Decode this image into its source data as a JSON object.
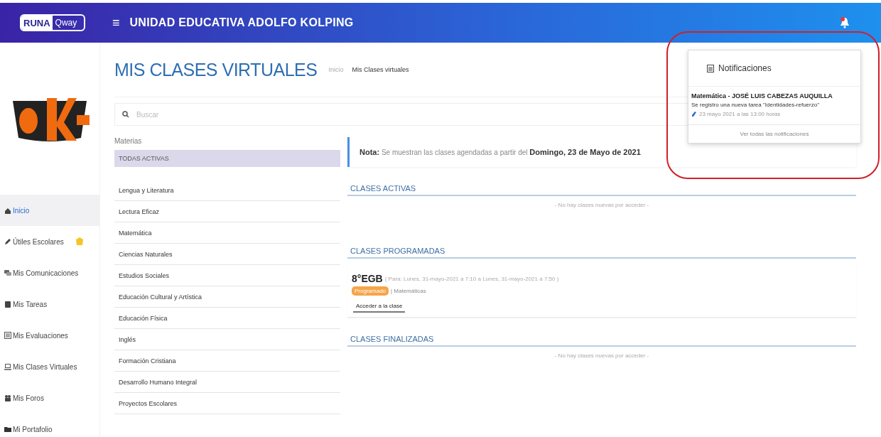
{
  "header": {
    "logo_main": "RUNA",
    "logo_tail": "Qway",
    "menu_glyph": "≡",
    "school": "UNIDAD EDUCATIVA ADOLFO KOLPING"
  },
  "sidebar": {
    "items": [
      {
        "label": "Inicio",
        "selected": true
      },
      {
        "label": "Útiles Escolares",
        "selected": false,
        "badge": true
      },
      {
        "label": "Mis Comunicaciones",
        "selected": false
      },
      {
        "label": "Mis Tareas",
        "selected": false
      },
      {
        "label": "Mis Evaluaciones",
        "selected": false
      },
      {
        "label": "Mis Clases Virtuales",
        "selected": false
      },
      {
        "label": "Mis Foros",
        "selected": false
      },
      {
        "label": "Mi Portafolio",
        "selected": false
      }
    ]
  },
  "page": {
    "title": "MIS CLASES VIRTUALES",
    "breadcrumb": [
      "Inicio",
      "Mis Clases virtuales"
    ]
  },
  "search": {
    "placeholder": "Buscar"
  },
  "subjects": {
    "heading": "Materias",
    "items": [
      {
        "label": "TODAS ACTIVAS",
        "selected": true
      },
      {
        "label": "Lengua y Literatura",
        "selected": false
      },
      {
        "label": "Lectura Eficaz",
        "selected": false
      },
      {
        "label": "Matemática",
        "selected": false
      },
      {
        "label": "Ciencias Naturales",
        "selected": false
      },
      {
        "label": "Estudios Sociales",
        "selected": false
      },
      {
        "label": "Educación Cultural y Artística",
        "selected": false
      },
      {
        "label": "Educación Física",
        "selected": false
      },
      {
        "label": "Inglés",
        "selected": false
      },
      {
        "label": "Formación Cristiana",
        "selected": false
      },
      {
        "label": "Desarrollo Humano Integral",
        "selected": false
      },
      {
        "label": "Proyectos Escolares",
        "selected": false
      }
    ]
  },
  "note": "**Nota:** Se muestran las clases agendadas a partir del **Domingo, 23 de Mayo de 2021**",
  "sections": [
    {
      "title": "CLASES ACTIVAS",
      "empty_text": "- No hay clases nuevas por acceder -"
    },
    {
      "title": "CLASES PROGRAMADAS",
      "classes": [
        {
          "name": "8°EGB",
          "schedule": "( Para: Lunes, 31-mayo-2021 a 7:10 a Lunes, 31-mayo-2021 a 7:50 )",
          "status": "Programado",
          "subject": "| Matemáticas",
          "action": "Acceder a la clase"
        }
      ]
    },
    {
      "title": "CLASES FINALIZADAS",
      "empty_text": "- No hay clases nuevas por acceder -"
    }
  ],
  "notifications": {
    "title": "Notificaciones",
    "items": [
      {
        "title": "Matemática - JOSÉ LUIS CABEZAS AUQUILLA",
        "text": "Se registro una nueva tarea \"Identidades-refuerzo\"",
        "time": "23 mayo 2021 a las 13:00 horas"
      }
    ],
    "footer": "Ver todas las notificaciones"
  }
}
